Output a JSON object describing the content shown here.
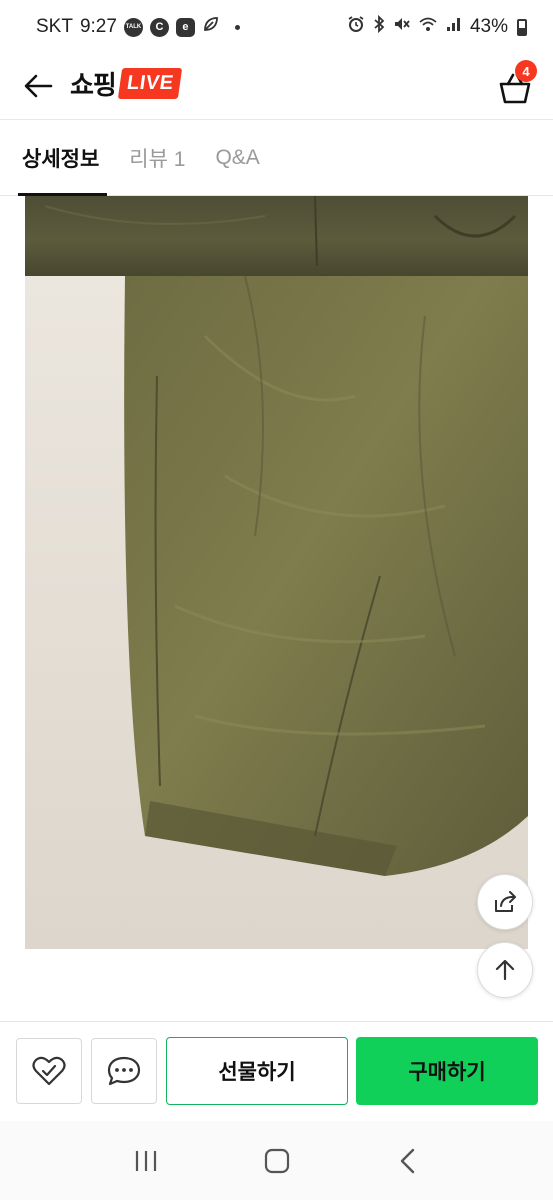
{
  "status_bar": {
    "carrier": "SKT",
    "time": "9:27",
    "notification_icons": [
      "talk-icon",
      "c-icon",
      "e-icon",
      "leaf-icon"
    ],
    "system_icons": [
      "alarm-icon",
      "bluetooth-icon",
      "mute-icon",
      "wifi-icon",
      "signal-icon"
    ],
    "battery": "43%"
  },
  "header": {
    "brand": "쇼핑",
    "badge": "LIVE",
    "brand_color": "#f5381f",
    "cart_count": "4"
  },
  "tabs": [
    {
      "label": "상세정보",
      "active": true
    },
    {
      "label": "리뷰 1",
      "active": false
    },
    {
      "label": "Q&A",
      "active": false
    }
  ],
  "floating": {
    "share_icon": "share-icon",
    "scroll_top_icon": "arrow-up-icon"
  },
  "actions": {
    "wishlist_icon": "heart-check-icon",
    "chat_icon": "chat-bubble-icon",
    "gift_label": "선물하기",
    "buy_label": "구매하기",
    "accent": "#10d05a"
  },
  "system_nav": [
    "recents-icon",
    "home-icon",
    "back-icon"
  ]
}
